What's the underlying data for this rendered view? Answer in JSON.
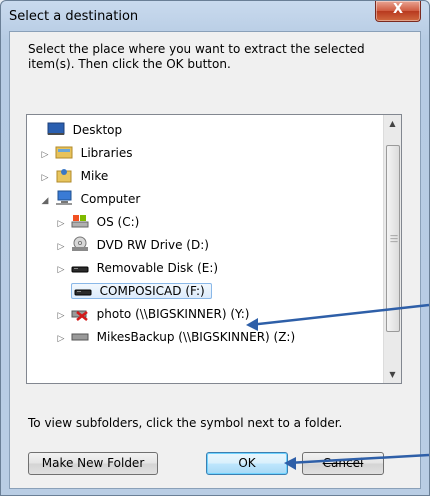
{
  "window": {
    "title": "Select a destination",
    "close_label": "X"
  },
  "instructions": "Select the place where you want to extract the selected item(s).  Then click the OK button.",
  "tree": {
    "items": [
      {
        "label": "Desktop",
        "icon": "desktop-icon",
        "expander": ""
      },
      {
        "label": "Libraries",
        "icon": "libraries-icon",
        "expander": "collapsed"
      },
      {
        "label": "Mike",
        "icon": "user-folder-icon",
        "expander": "collapsed"
      },
      {
        "label": "Computer",
        "icon": "computer-icon",
        "expander": "expanded"
      },
      {
        "label": "OS (C:)",
        "icon": "drive-icon",
        "expander": "collapsed"
      },
      {
        "label": "DVD RW Drive (D:)",
        "icon": "dvd-drive-icon",
        "expander": "collapsed"
      },
      {
        "label": "Removable Disk (E:)",
        "icon": "removable-disk-icon",
        "expander": "collapsed"
      },
      {
        "label": "COMPOSICAD (F:)",
        "icon": "removable-disk-icon",
        "expander": "",
        "selected": true
      },
      {
        "label": "photo (\\\\BIGSKINNER) (Y:)",
        "icon": "disconnected-network-drive-icon",
        "expander": "collapsed"
      },
      {
        "label": "MikesBackup (\\\\BIGSKINNER) (Z:)",
        "icon": "network-drive-icon",
        "expander": "collapsed"
      }
    ]
  },
  "footer_hint": "To view subfolders, click the symbol next to a folder.",
  "buttons": {
    "make_new_folder": "Make New Folder",
    "ok": "OK",
    "cancel": "Cancel"
  },
  "colors": {
    "selection_border": "#8ab8e8",
    "annotation_arrow": "#2e5fa8",
    "close_button": "#c8462a"
  }
}
